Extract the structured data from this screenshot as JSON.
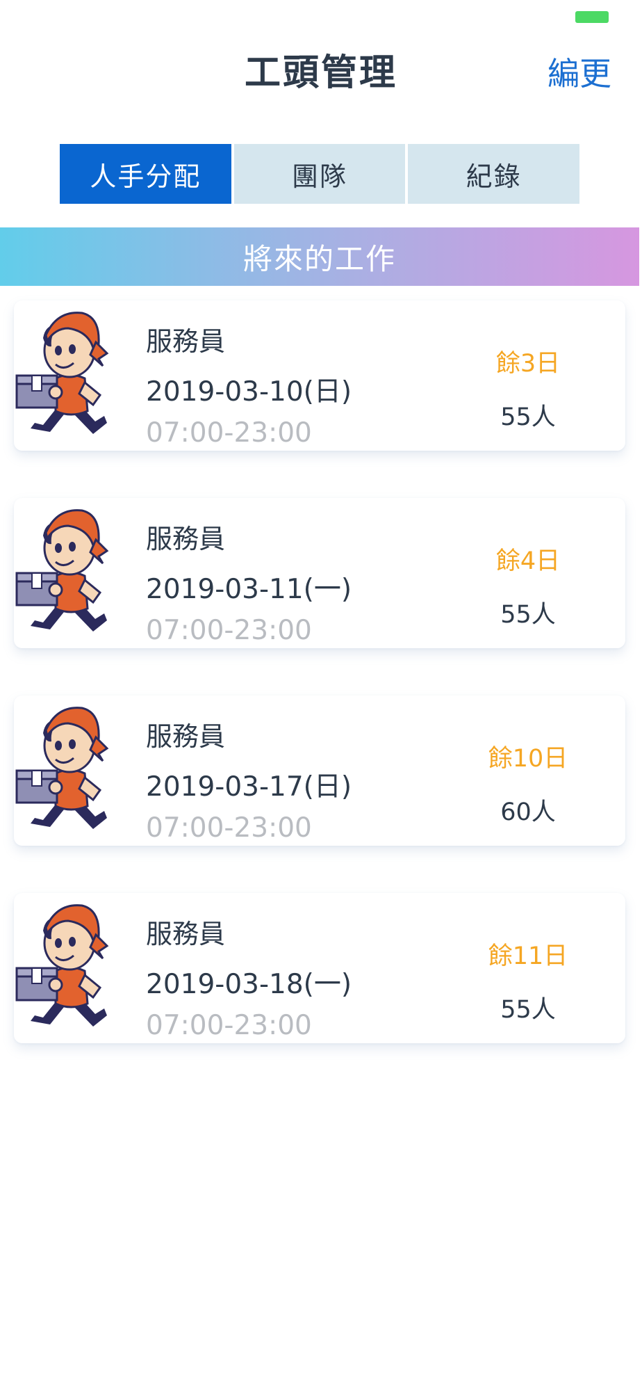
{
  "status_bar": {
    "battery_color": "#4cd964"
  },
  "header": {
    "title": "工頭管理",
    "edit_label": "編更"
  },
  "tabs": [
    {
      "label": "人手分配",
      "active": true
    },
    {
      "label": "團隊",
      "active": false
    },
    {
      "label": "紀錄",
      "active": false
    }
  ],
  "banner": {
    "title": "將來的工作"
  },
  "jobs": [
    {
      "role": "服務員",
      "date": "2019-03-10(日)",
      "time": "07:00-23:00",
      "remaining": "餘3日",
      "people": "55人"
    },
    {
      "role": "服務員",
      "date": "2019-03-11(一)",
      "time": "07:00-23:00",
      "remaining": "餘4日",
      "people": "55人"
    },
    {
      "role": "服務員",
      "date": "2019-03-17(日)",
      "time": "07:00-23:00",
      "remaining": "餘10日",
      "people": "60人"
    },
    {
      "role": "服務員",
      "date": "2019-03-18(一)",
      "time": "07:00-23:00",
      "remaining": "餘11日",
      "people": "55人"
    }
  ],
  "colors": {
    "accent": "#0a66d0",
    "tab_inactive": "#d5e6ee",
    "remaining": "#f5a623",
    "banner_start": "#62cdea",
    "banner_end": "#d697e0"
  },
  "icons": {
    "avatar": "delivery-worker-illustration"
  }
}
